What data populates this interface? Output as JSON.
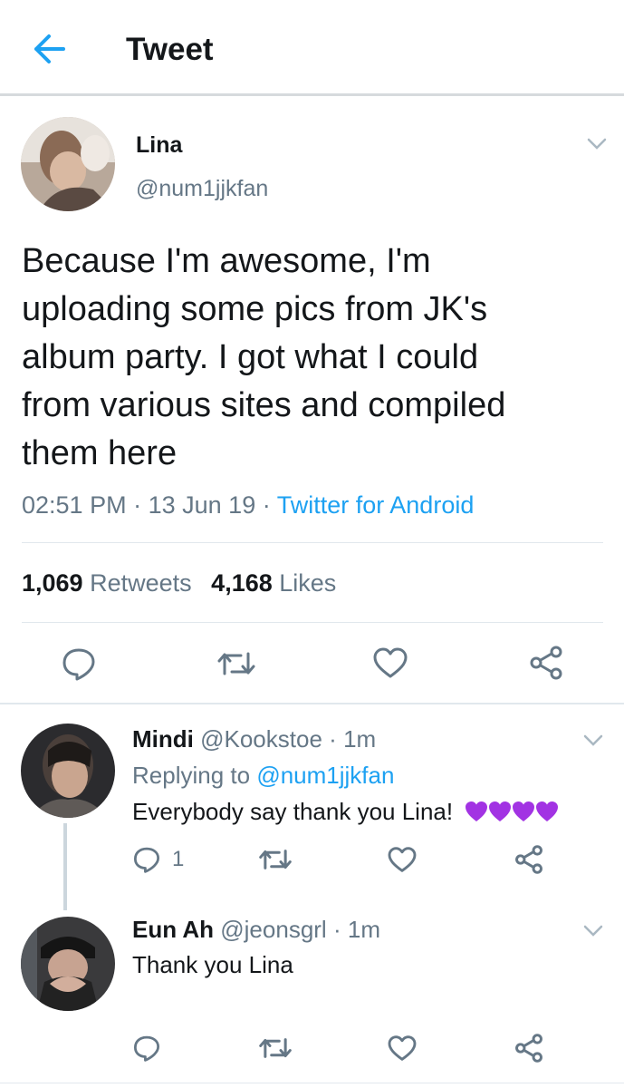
{
  "header": {
    "title": "Tweet"
  },
  "tweet": {
    "name": "Lina",
    "handle": "@num1jjkfan",
    "text_lines": [
      "Because I'm awesome, I'm",
      "uploading some pics from JK's",
      "album party. I got what I could",
      "from various sites and compiled",
      "them here"
    ],
    "time": "02:51 PM",
    "sep1": "·",
    "date": "13 Jun 19",
    "sep2": "·",
    "source": "Twitter for Android",
    "retweets_count": "1,069",
    "retweets_label": "Retweets",
    "likes_count": "4,168",
    "likes_label": "Likes"
  },
  "replies": [
    {
      "name": "Mindi",
      "handle": "@Kookstoe",
      "sep": "·",
      "time": "1m",
      "replying_label": "Replying to",
      "replying_to": "@num1jjkfan",
      "text": "Everybody say thank you Lina!",
      "emoji": "purple-heart x4",
      "reply_count": "1"
    },
    {
      "name": "Eun Ah",
      "handle": "@jeonsgrl",
      "sep": "·",
      "time": "1m",
      "text": "Thank you Lina"
    }
  ],
  "colors": {
    "accent": "#1da1f2",
    "muted": "#657786",
    "icon": "#657786",
    "purple_heart": "#a233e3"
  }
}
